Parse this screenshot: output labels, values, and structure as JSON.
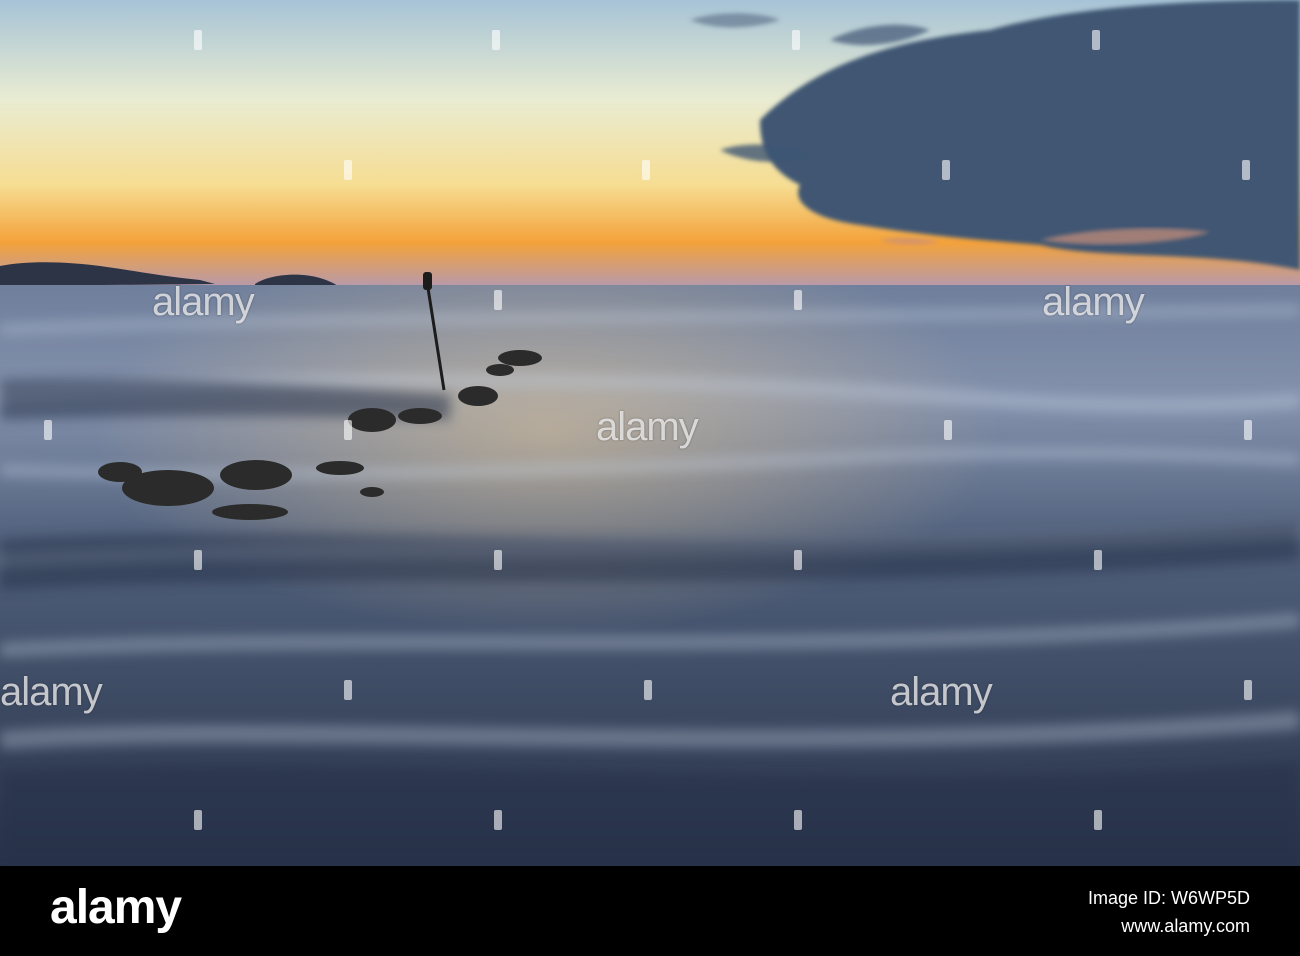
{
  "photo": {
    "watermark_text": "alamy",
    "colors": {
      "sky_top": "#8fb3cf",
      "sky_mid": "#f3ebc2",
      "horizon_glow": "#f4a23a",
      "sea_light": "#9aa8c0",
      "sea_dark": "#2a3548",
      "cloud": "#3e5572",
      "rock": "#2b2b2b"
    }
  },
  "footer": {
    "logo": "alamy",
    "image_id": "Image ID: W6WP5D",
    "url": "www.alamy.com"
  }
}
